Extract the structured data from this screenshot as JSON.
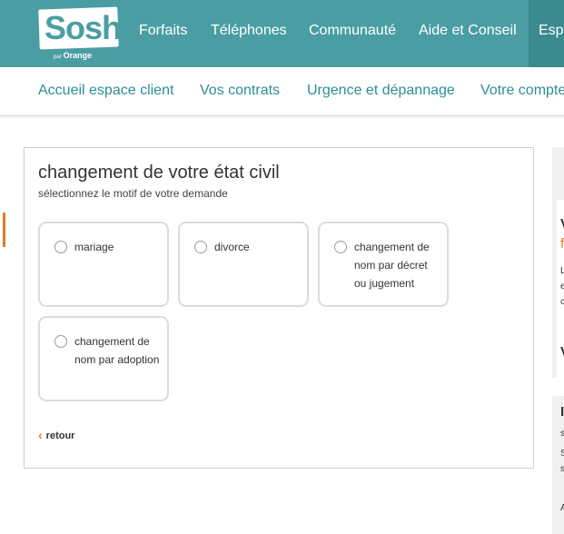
{
  "brand": {
    "name": "Sosh",
    "sub_prefix": "par",
    "sub": "Orange",
    "color": "#4a9ea3",
    "accent": "#e07b2d"
  },
  "topnav": {
    "items": [
      {
        "label": "Forfaits"
      },
      {
        "label": "Téléphones"
      },
      {
        "label": "Communauté"
      },
      {
        "label": "Aide et Conseil"
      },
      {
        "label": "Esp"
      }
    ]
  },
  "subnav": {
    "items": [
      {
        "label": "Accueil espace client"
      },
      {
        "label": "Vos contrats"
      },
      {
        "label": "Urgence et dépannage"
      },
      {
        "label": "Votre compte"
      }
    ]
  },
  "card": {
    "title": "changement de votre état civil",
    "subtitle": "sélectionnez le motif de votre demande",
    "options": [
      {
        "label": "mariage"
      },
      {
        "label": "divorce"
      },
      {
        "label": "changement de nom par décret ou jugement"
      },
      {
        "label": "changement de nom par adoption"
      }
    ],
    "back_label": "retour"
  },
  "sidebar": {
    "glyphs": [
      "V",
      "f",
      "L",
      "e",
      "c",
      "V",
      "I",
      "s",
      "S",
      "s",
      "A"
    ]
  }
}
